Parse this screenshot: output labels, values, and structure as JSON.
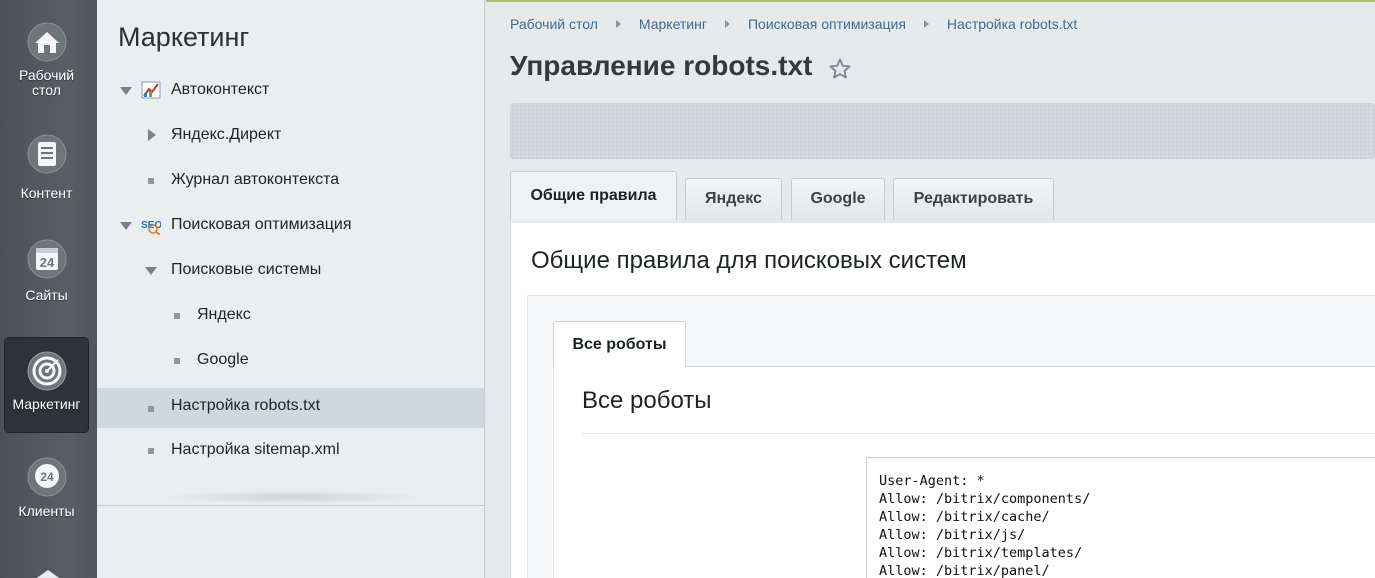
{
  "rail": {
    "items": [
      {
        "label": "Рабочий стол",
        "icon": "home-icon"
      },
      {
        "label": "Контент",
        "icon": "document-icon"
      },
      {
        "label": "Сайты",
        "icon": "calendar-24-icon"
      },
      {
        "label": "Маркетинг",
        "icon": "target-icon",
        "active": true
      },
      {
        "label": "Клиенты",
        "icon": "bubble-24-icon"
      }
    ]
  },
  "menu": {
    "title": "Маркетинг",
    "items": [
      {
        "label": "Автоконтекст",
        "expander": "expanded",
        "icon": "chart-icon"
      },
      {
        "label": "Яндекс.Директ",
        "expander": "collapsed"
      },
      {
        "label": "Журнал автоконтекста",
        "expander": "bullet"
      },
      {
        "label": "Поисковая оптимизация",
        "expander": "expanded",
        "icon": "seo-icon"
      },
      {
        "label": "Поисковые системы",
        "expander": "expanded"
      },
      {
        "label": "Яндекс",
        "expander": "bullet"
      },
      {
        "label": "Google",
        "expander": "bullet"
      },
      {
        "label": "Настройка robots.txt",
        "expander": "bullet",
        "selected": true
      },
      {
        "label": "Настройка sitemap.xml",
        "expander": "bullet"
      }
    ]
  },
  "breadcrumbs": [
    "Рабочий стол",
    "Маркетинг",
    "Поисковая оптимизация",
    "Настройка robots.txt"
  ],
  "page": {
    "title": "Управление robots.txt"
  },
  "tabs": [
    {
      "label": "Общие правила",
      "active": true
    },
    {
      "label": "Яндекс"
    },
    {
      "label": "Google"
    },
    {
      "label": "Редактировать"
    }
  ],
  "section": {
    "title": "Общие правила для поисковых систем",
    "inner_tab": "Все роботы",
    "robots_title": "Все роботы",
    "code": "User-Agent: *\nAllow: /bitrix/components/\nAllow: /bitrix/cache/\nAllow: /bitrix/js/\nAllow: /bitrix/templates/\nAllow: /bitrix/panel/"
  },
  "colors": {
    "rail_bg": "#585f64",
    "accent_line": "#a6c46a",
    "link": "#46688d"
  }
}
